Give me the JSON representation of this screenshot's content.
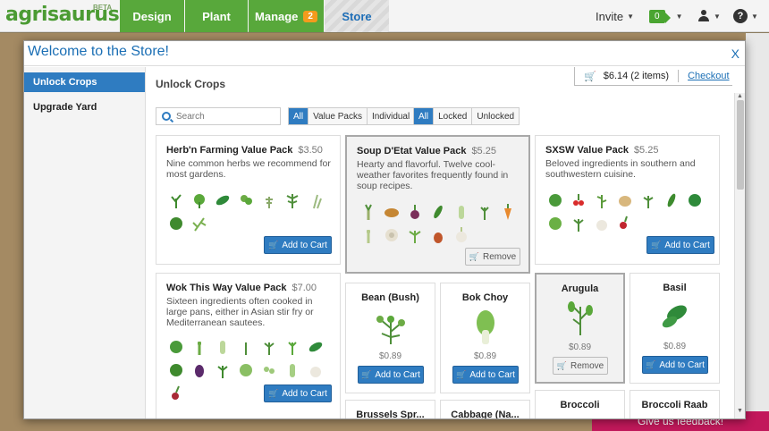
{
  "nav": {
    "logo": "agrisaurus",
    "logo_badge": "BETA",
    "tabs": [
      {
        "label": "Design"
      },
      {
        "label": "Plant"
      },
      {
        "label": "Manage",
        "badge": "2"
      },
      {
        "label": "Store"
      }
    ],
    "invite_label": "Invite",
    "coins": "0",
    "accent": "#58a83b"
  },
  "modal": {
    "title": "Welcome to the Store!",
    "close": "X",
    "sidebar": [
      {
        "label": "Unlock Crops",
        "active": true
      },
      {
        "label": "Upgrade Yard",
        "active": false
      }
    ],
    "section_title": "Unlock Crops",
    "cart": {
      "total": "$6.14",
      "items": "(2 items)",
      "checkout": "Checkout"
    },
    "search_placeholder": "Search",
    "filter_type": [
      "All",
      "Value Packs",
      "Individual"
    ],
    "filter_lock": [
      "All",
      "Locked",
      "Unlocked"
    ],
    "packs": [
      {
        "name": "Herb'n Farming Value Pack",
        "price": "$3.50",
        "desc": "Nine common herbs we recommend for most gardens.",
        "button": "Add to Cart"
      },
      {
        "name": "Soup D'Etat Value Pack",
        "price": "$5.25",
        "desc": "Hearty and flavorful. Twelve cool-weather favorites frequently found in soup recipes.",
        "button": "Remove"
      },
      {
        "name": "SXSW Value Pack",
        "price": "$5.25",
        "desc": "Beloved ingredients in southern and southwestern cuisine.",
        "button": "Add to Cart"
      },
      {
        "name": "Wok This Way Value Pack",
        "price": "$7.00",
        "desc": "Sixteen ingredients often cooked in large pans, either in Asian stir fry or Mediterranean sautees.",
        "button": "Add to Cart"
      }
    ],
    "crops": [
      {
        "name": "Bean (Bush)",
        "price": "$0.89",
        "button": "Add to Cart"
      },
      {
        "name": "Bok Choy",
        "price": "$0.89",
        "button": "Add to Cart"
      },
      {
        "name": "Arugula",
        "price": "$0.89",
        "button": "Remove"
      },
      {
        "name": "Basil",
        "price": "$0.89",
        "button": "Add to Cart"
      },
      {
        "name": "Broccoli",
        "price": ""
      },
      {
        "name": "Broccoli Raab",
        "price": ""
      },
      {
        "name": "Brussels Spr...",
        "price": ""
      },
      {
        "name": "Cabbage (Na...",
        "price": ""
      }
    ]
  },
  "feedback": "Give us feedback!"
}
